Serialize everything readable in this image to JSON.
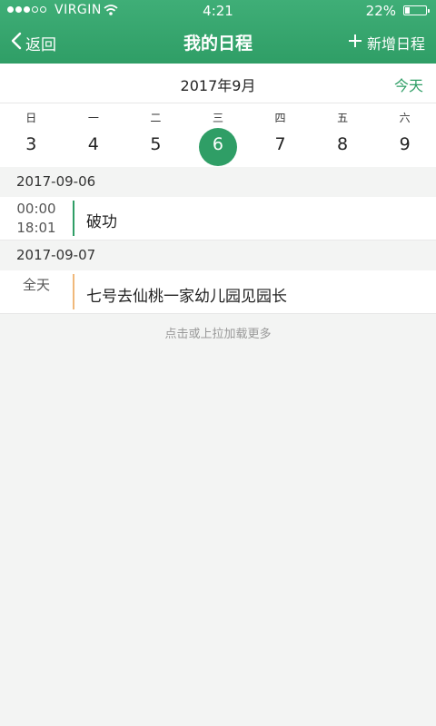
{
  "status_bar": {
    "carrier": "VIRGIN",
    "time": "4:21",
    "battery_percent": "22%",
    "battery_level": 0.22,
    "signal_bars": 3
  },
  "nav": {
    "back_label": "返回",
    "title": "我的日程",
    "add_label": "新增日程",
    "icons": [
      "chevron-left-icon",
      "plus-icon"
    ]
  },
  "month_bar": {
    "month_label": "2017年9月",
    "today_label": "今天"
  },
  "week": {
    "days": [
      {
        "weekday": "日",
        "date": "3"
      },
      {
        "weekday": "一",
        "date": "4"
      },
      {
        "weekday": "二",
        "date": "5"
      },
      {
        "weekday": "三",
        "date": "6",
        "selected": true
      },
      {
        "weekday": "四",
        "date": "7"
      },
      {
        "weekday": "五",
        "date": "8"
      },
      {
        "weekday": "六",
        "date": "9"
      }
    ]
  },
  "agenda": {
    "groups": [
      {
        "date": "2017-09-06",
        "events": [
          {
            "start": "00:00",
            "end": "18:01",
            "title": "破功",
            "bar_color": "#2f9e66"
          }
        ]
      },
      {
        "date": "2017-09-07",
        "events": [
          {
            "time": "全天",
            "title": "七号去仙桃一家幼儿园见园长",
            "bar_color": "#f0b87a"
          }
        ]
      }
    ],
    "load_more": "点击或上拉加载更多"
  },
  "colors": {
    "accent": "#2f9e66",
    "header_top": "#3fae77",
    "allday_bar": "#f0b87a"
  }
}
